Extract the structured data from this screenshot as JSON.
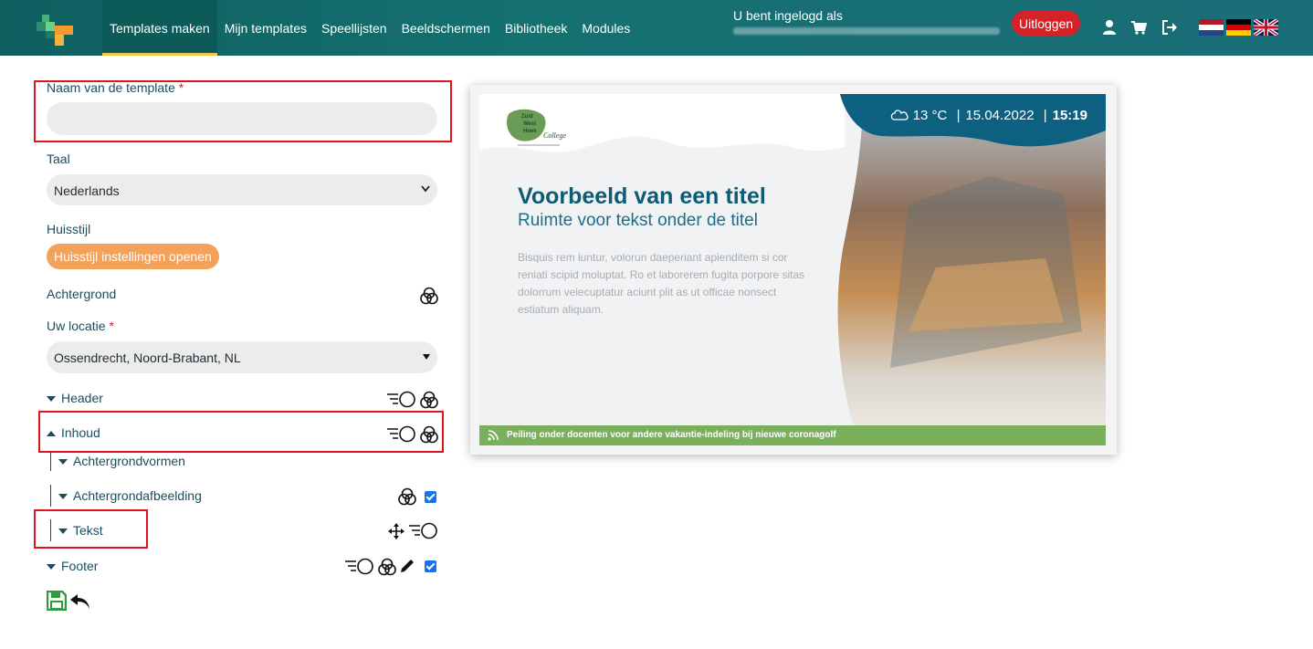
{
  "nav": {
    "items": [
      {
        "label": "Templates maken",
        "active": true
      },
      {
        "label": "Mijn templates"
      },
      {
        "label": "Speellijsten"
      },
      {
        "label": "Beeldschermen"
      },
      {
        "label": "Bibliotheek"
      },
      {
        "label": "Modules"
      }
    ],
    "login_label": "U bent ingelogd als",
    "logout_label": "Uitloggen",
    "icons": [
      "user-icon",
      "cart-icon",
      "sign-out-icon"
    ],
    "flags": [
      "flag-nl",
      "flag-de",
      "flag-uk"
    ]
  },
  "form": {
    "name_label": "Naam van de template",
    "name_required_mark": "*",
    "name_value": "",
    "language_label": "Taal",
    "language_value": "Nederlands",
    "house_style_label": "Huisstijl",
    "house_style_button": "Huisstijl instellingen openen",
    "background_label": "Achtergrond",
    "location_label": "Uw locatie",
    "location_required_mark": "*",
    "location_value": "Ossendrecht, Noord-Brabant, NL",
    "tree": {
      "header": "Header",
      "inhoud": "Inhoud",
      "achtergrondvormen": "Achtergrondvormen",
      "achtergrondafbeelding": "Achtergrondafbeelding",
      "tekst": "Tekst",
      "footer": "Footer"
    },
    "achtergrondafbeelding_checked": true,
    "footer_checked": true
  },
  "preview": {
    "logo_text": "Zuid West Hoek College",
    "weather": {
      "temp": "13 °C",
      "date": "15.04.2022",
      "time": "15:19"
    },
    "title": "Voorbeeld van een titel",
    "subtitle": "Ruimte voor tekst onder de titel",
    "body": "Bisquis rem iuntur, volorun daeperiant apienditem si cor reniati scipid moluptat. Ro et laborerem fugita porpore sitas dolorrum velecuptatur aciunt plit as ut officae nonsect estiatum aliquam.",
    "ticker": "Peiling onder docenten voor andere vakantie-indeling bij nieuwe coronagolf"
  }
}
